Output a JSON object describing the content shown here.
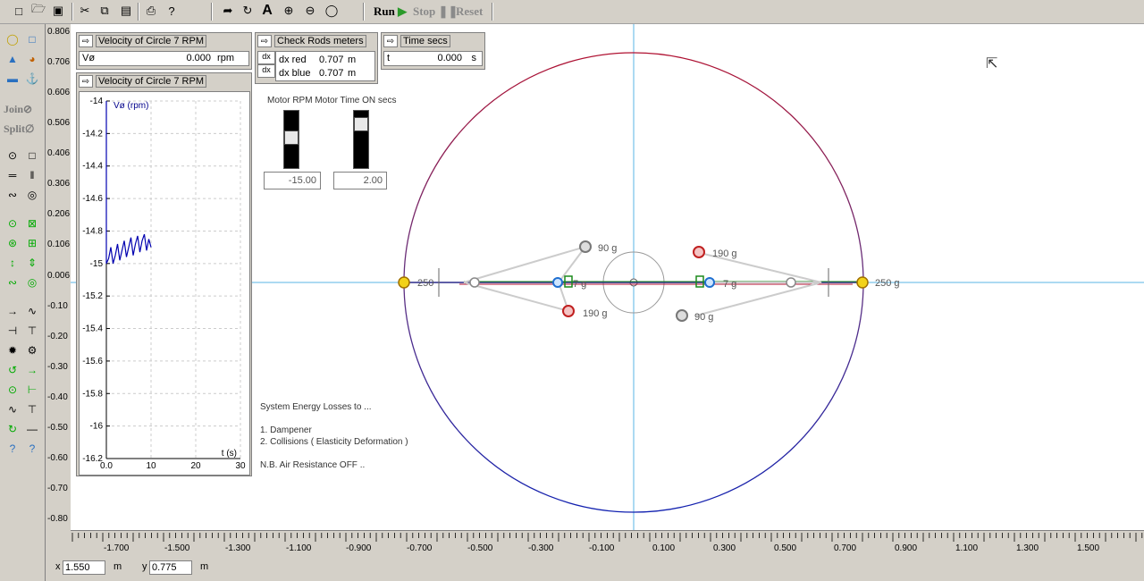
{
  "toolbar": {
    "icons": [
      "new-file-icon",
      "open-folder-icon",
      "save-icon",
      "cut-icon",
      "copy-icon",
      "paste-icon",
      "print-icon",
      "help-icon",
      "pointer-icon",
      "rotate-icon",
      "text-icon",
      "zoom-in-icon",
      "zoom-out-icon",
      "zoom-fit-icon"
    ],
    "run_label": "Run",
    "stop_label": "Stop",
    "reset_label": "Reset"
  },
  "palette": {
    "join_label": "Join",
    "split_label": "Split"
  },
  "meters": {
    "velocity_top": {
      "title": "Velocity of Circle 7 RPM",
      "symbol": "Vø",
      "value": "0.000",
      "unit": "rpm"
    },
    "check_rods": {
      "title": "Check Rods meters",
      "rows": [
        {
          "label": "dx red",
          "value": "0.707",
          "unit": "m"
        },
        {
          "label": "dx blue",
          "value": "0.707",
          "unit": "m"
        }
      ]
    },
    "time": {
      "title": "Time secs",
      "symbol": "t",
      "value": "0.000",
      "unit": "s"
    },
    "velocity_graph": {
      "title": "Velocity of Circle 7 RPM",
      "y_label": "Vø (rpm)",
      "x_label": "t (s)"
    }
  },
  "sliders": {
    "label": "Motor RPM Motor Time ON secs",
    "motor_rpm_value": "-15.00",
    "motor_time_value": "2.00",
    "motor_rpm_level": 0.55,
    "motor_time_level": 0.85
  },
  "notes": {
    "line1": "System Energy Losses to ...",
    "line2": "1. Dampener",
    "line3": "2. Collisions ( Elasticity Deformation )",
    "line4": "N.B. Air Resistance OFF .."
  },
  "masses": {
    "top_left": "90 g",
    "bottom_left": "190 g",
    "left_inner": "7 g",
    "left_outer": "250",
    "top_right": "190 g",
    "bottom_right": "90 g",
    "right_inner": "7 g",
    "right_outer": "250 g"
  },
  "vertical_ruler": [
    "0.806",
    "0.706",
    "0.606",
    "0.506",
    "0.406",
    "0.306",
    "0.206",
    "0.106",
    "0.006",
    "-0.10",
    "-0.20",
    "-0.30",
    "-0.40",
    "-0.50",
    "-0.60",
    "-0.70",
    "-0.80"
  ],
  "horizontal_ruler": [
    "-1.700",
    "-1.500",
    "-1.300",
    "-1.100",
    "-0.900",
    "-0.700",
    "-0.500",
    "-0.300",
    "-0.100",
    "0.100",
    "0.300",
    "0.500",
    "0.700",
    "0.900",
    "1.100",
    "1.300",
    "1.500"
  ],
  "status": {
    "x_label": "x",
    "x_value": "1.550",
    "x_unit": "m",
    "y_label": "y",
    "y_value": "0.775",
    "y_unit": "m"
  },
  "chart_data": {
    "type": "line",
    "title": "Velocity of Circle 7 RPM",
    "xlabel": "t (s)",
    "ylabel": "Vø (rpm)",
    "xlim": [
      0,
      30
    ],
    "ylim": [
      -16.2,
      -14
    ],
    "x_ticks": [
      "0.0",
      "10",
      "20",
      "30"
    ],
    "y_ticks": [
      "-14",
      "-14.2",
      "-14.4",
      "-14.6",
      "-14.8",
      "-15",
      "-15.2",
      "-15.4",
      "-15.6",
      "-15.8",
      "-16",
      "-16.2"
    ],
    "series": [
      {
        "x": [
          0,
          0.5,
          1,
          1.5,
          2,
          2.5,
          3,
          3.5,
          4,
          4.5,
          5,
          5.5,
          6,
          6.5,
          7,
          7.5,
          8,
          8.5,
          9,
          9.5,
          10
        ],
        "values": [
          -15,
          -14.97,
          -14.9,
          -15,
          -14.95,
          -14.88,
          -14.98,
          -14.92,
          -14.86,
          -14.96,
          -14.9,
          -14.84,
          -14.95,
          -14.88,
          -14.83,
          -14.93,
          -14.86,
          -14.82,
          -14.92,
          -14.85,
          -14.9
        ]
      }
    ],
    "grid": true
  }
}
